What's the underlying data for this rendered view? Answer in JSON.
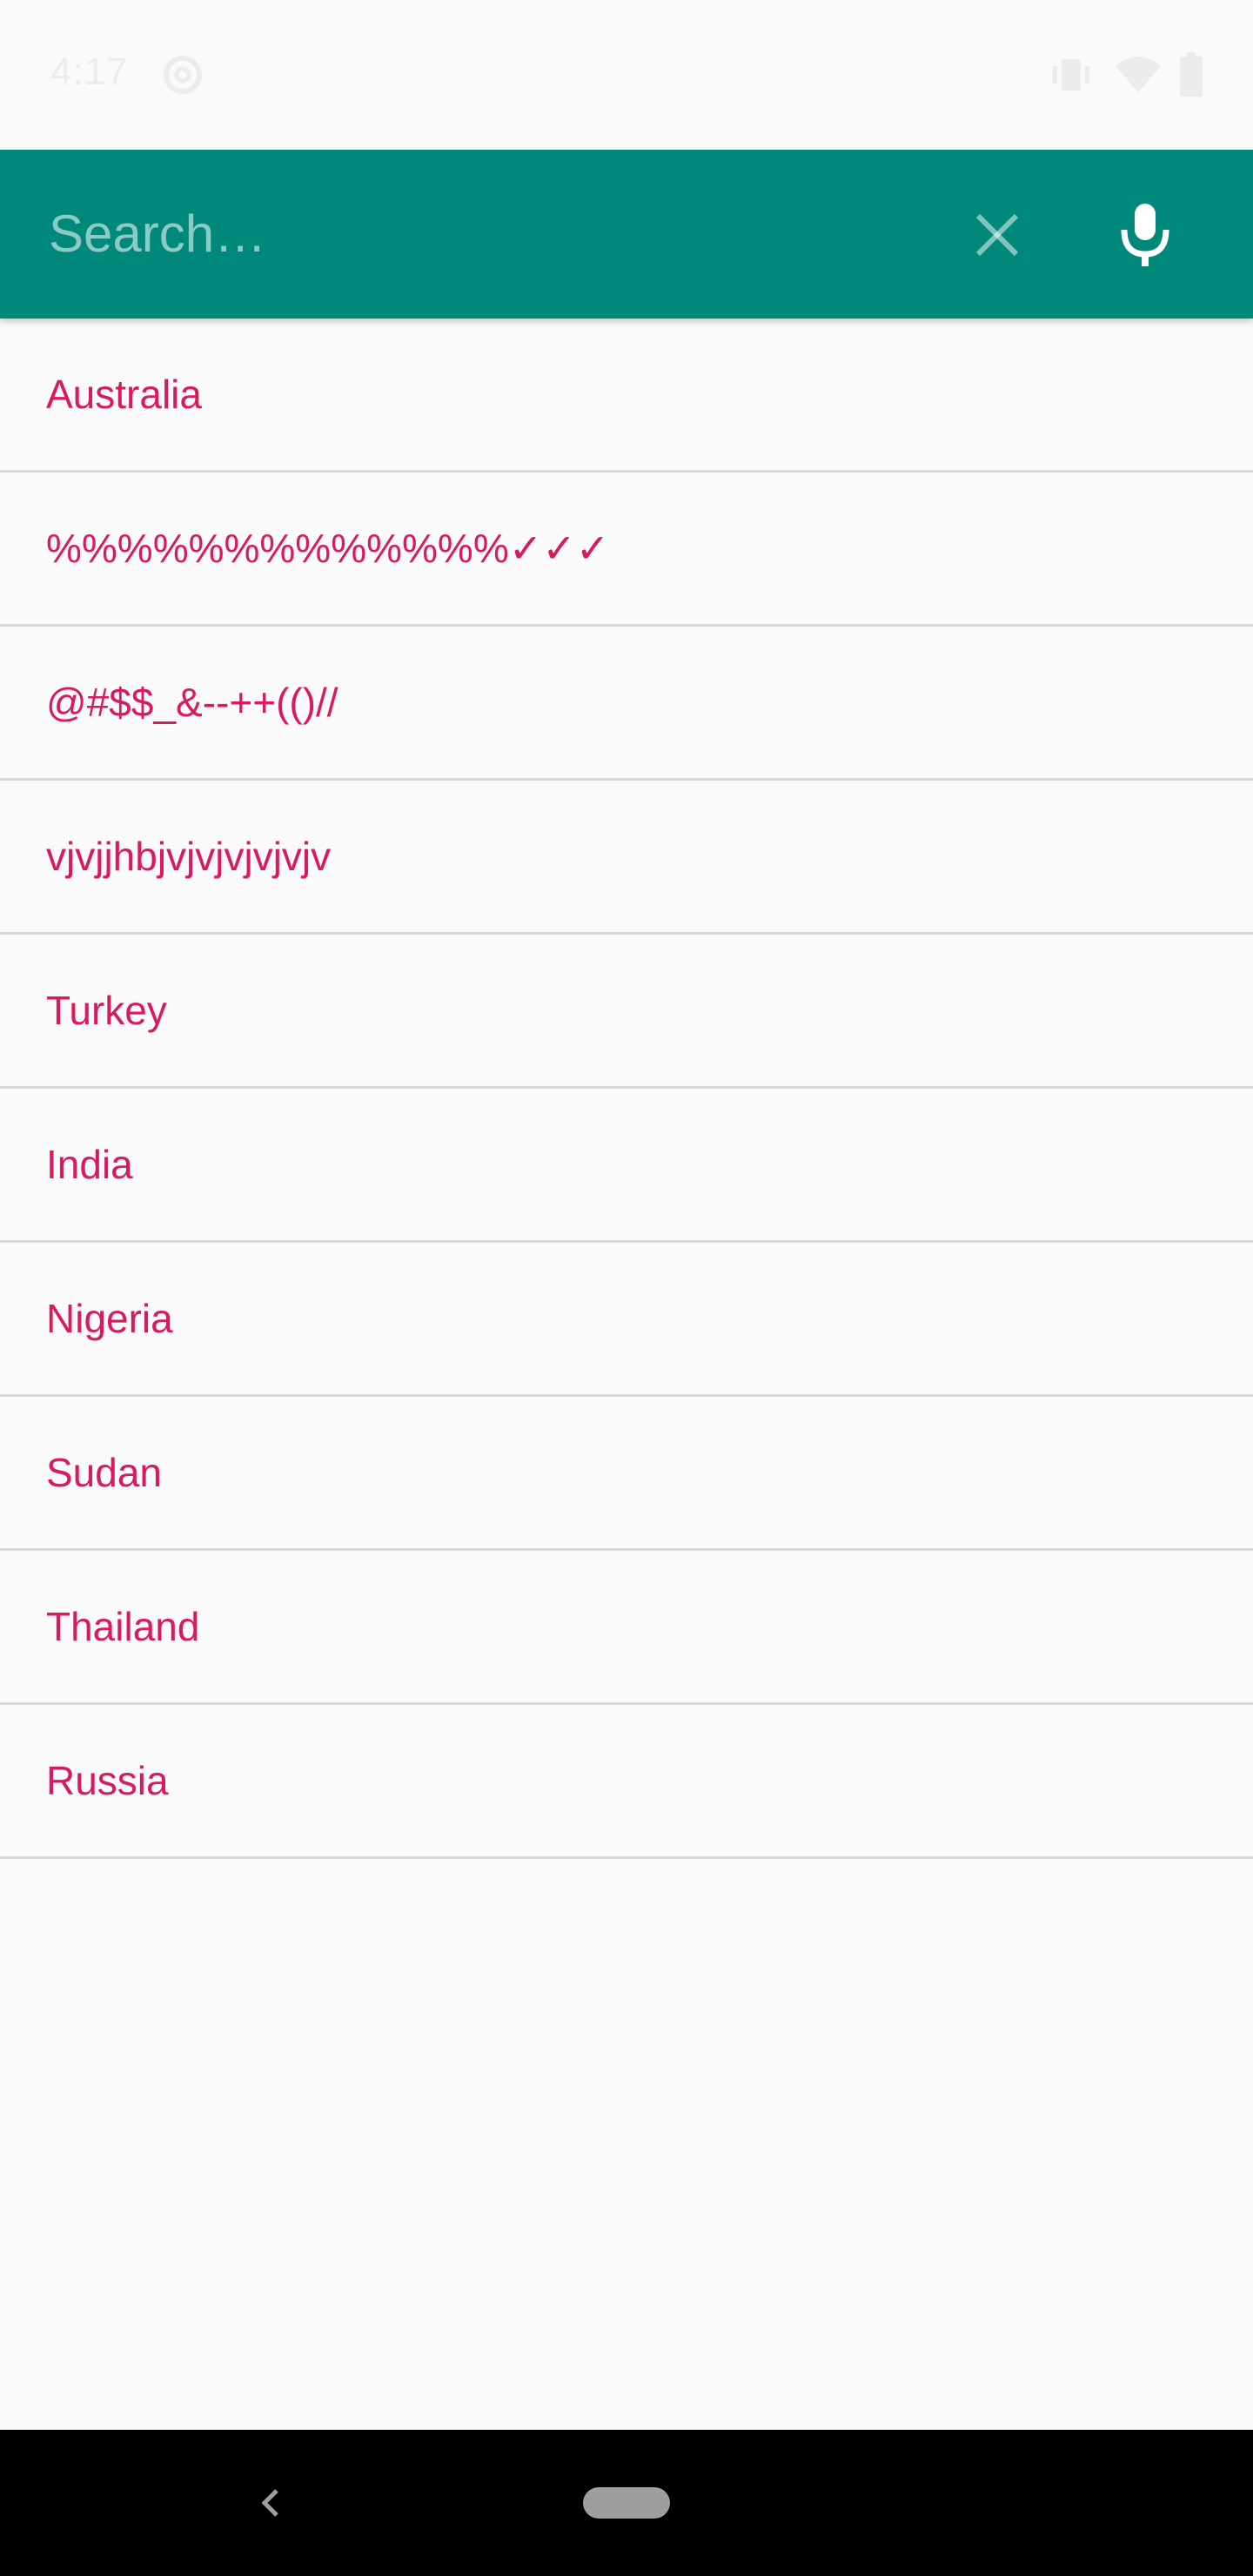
{
  "status_bar": {
    "time": "4:17",
    "icons": [
      "sync-icon",
      "vibrate-icon",
      "wifi-icon",
      "battery-icon"
    ]
  },
  "search": {
    "placeholder": "Search…",
    "value": "",
    "clear_icon": "close-icon",
    "mic_icon": "mic-icon"
  },
  "list": {
    "items": [
      {
        "label": "Australia"
      },
      {
        "label": "%%%%%%%%%%%%%✓✓✓"
      },
      {
        "label": "@#$$_&--++(()//"
      },
      {
        "label": "vjvjjhbjvjvjvjvjvjv"
      },
      {
        "label": "Turkey"
      },
      {
        "label": "India"
      },
      {
        "label": "Nigeria"
      },
      {
        "label": "Sudan"
      },
      {
        "label": "Thailand"
      },
      {
        "label": "Russia"
      }
    ]
  },
  "nav_bar": {
    "back_icon": "back-icon",
    "home_icon": "home-pill-icon"
  },
  "colors": {
    "app_bar": "#00897b",
    "item_text": "#d81b60",
    "background": "#fafafa",
    "divider": "#d9d9d9"
  }
}
